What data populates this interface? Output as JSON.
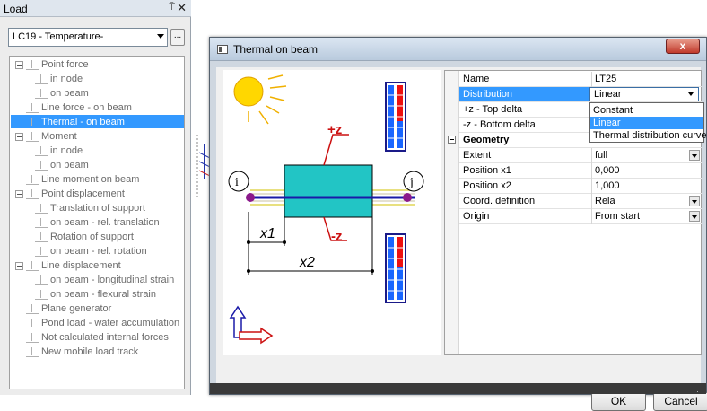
{
  "load_panel": {
    "title": "Load",
    "pin": "⍑",
    "close": "✕",
    "load_case": "LC19 - Temperature-",
    "more_button": "...",
    "tree": [
      {
        "label": "Point force",
        "level": 0,
        "toggle": true
      },
      {
        "label": "in node",
        "level": 1
      },
      {
        "label": "on beam",
        "level": 1
      },
      {
        "label": "Line force - on beam",
        "level": 0
      },
      {
        "label": "Thermal - on beam",
        "level": 0,
        "selected": true
      },
      {
        "label": "Moment",
        "level": 0,
        "toggle": true
      },
      {
        "label": "in node",
        "level": 1
      },
      {
        "label": "on beam",
        "level": 1
      },
      {
        "label": "Line moment on beam",
        "level": 0
      },
      {
        "label": "Point displacement",
        "level": 0,
        "toggle": true
      },
      {
        "label": "Translation of support",
        "level": 1
      },
      {
        "label": "on beam - rel. translation",
        "level": 1
      },
      {
        "label": "Rotation of support",
        "level": 1
      },
      {
        "label": "on beam - rel. rotation",
        "level": 1
      },
      {
        "label": "Line displacement",
        "level": 0,
        "toggle": true
      },
      {
        "label": "on beam - longitudinal strain",
        "level": 1
      },
      {
        "label": "on beam - flexural strain",
        "level": 1
      },
      {
        "label": "Plane generator",
        "level": 0
      },
      {
        "label": "Pond load - water accumulation",
        "level": 0
      },
      {
        "label": "Not calculated internal forces",
        "level": 0
      },
      {
        "label": "New mobile load track",
        "level": 0
      }
    ]
  },
  "dialog": {
    "title": "Thermal on beam",
    "close": "x",
    "picture": {
      "plus_z": "+z",
      "minus_z": "-z",
      "node_i": "i",
      "node_j": "j",
      "x1": "x1",
      "x2": "x2"
    },
    "properties": [
      {
        "label": "Name",
        "value": "LT25"
      },
      {
        "label": "Distribution",
        "value": "Linear",
        "selected": true,
        "dropdown": true
      },
      {
        "label": "+z - Top delta",
        "value": ""
      },
      {
        "label": "-z - Bottom delta",
        "value": ""
      },
      {
        "label": "Geometry",
        "value": "",
        "header": true
      },
      {
        "label": "Extent",
        "value": "full",
        "dropdown": true
      },
      {
        "label": "Position x1",
        "value": "0,000"
      },
      {
        "label": "Position x2",
        "value": "1,000"
      },
      {
        "label": "Coord. definition",
        "value": "Rela",
        "dropdown": true
      },
      {
        "label": "Origin",
        "value": "From start",
        "dropdown": true
      }
    ],
    "distribution_options": [
      "Constant",
      "Linear",
      "Thermal distribution curve"
    ],
    "distribution_selected": "Linear",
    "ok": "OK",
    "cancel": "Cancel"
  },
  "colors": {
    "selection": "#3399ff",
    "beam": "#22c5c5",
    "beam_axis": "#1a1aa8",
    "node_marker": "#8b1a8b",
    "annotation": "#cc1111",
    "sun": "#ffd700"
  }
}
